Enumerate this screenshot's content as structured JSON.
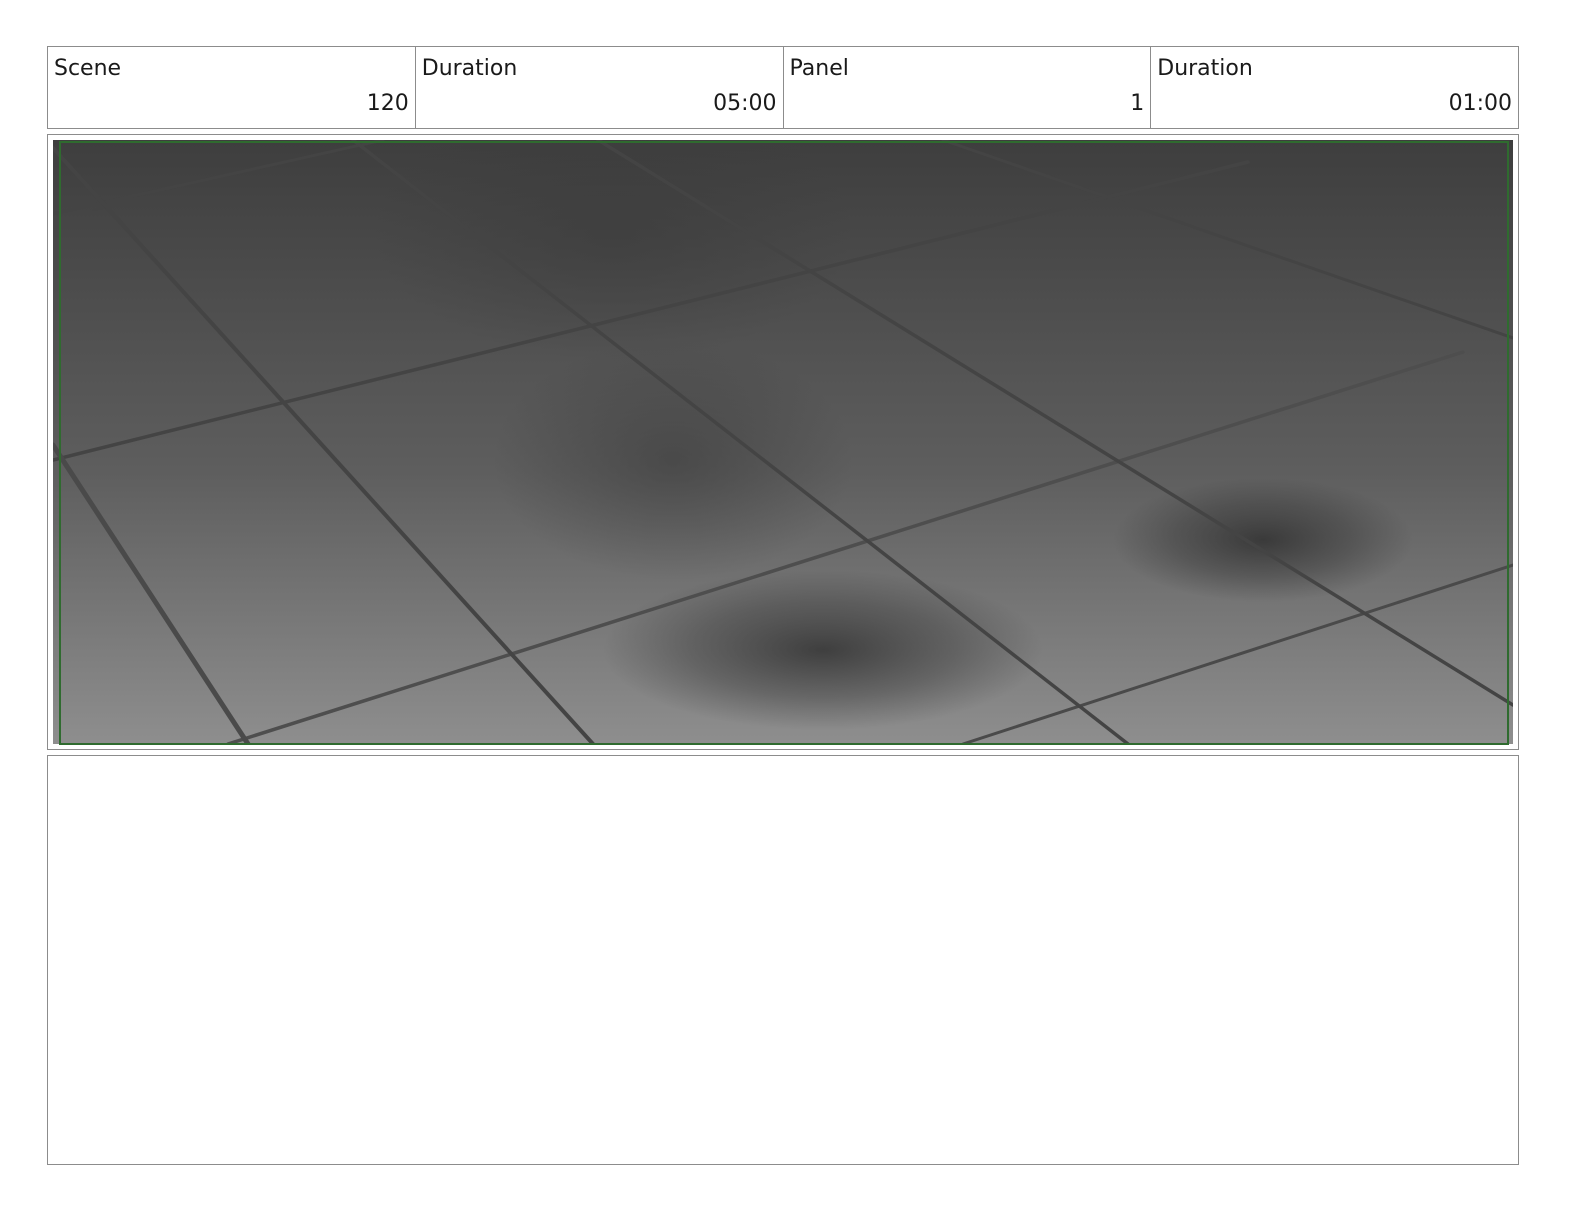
{
  "header": {
    "scene_label": "Scene",
    "scene_value": "120",
    "scene_duration_label": "Duration",
    "scene_duration_value": "05:00",
    "panel_label": "Panel",
    "panel_value": "1",
    "panel_duration_label": "Duration",
    "panel_duration_value": "01:00"
  },
  "panel": {
    "safe_frame_color": "#2f6b2f",
    "floor_colors": {
      "top": "#3e3e3e",
      "bottom": "#8e8e8e",
      "grid_line": "#444444",
      "shadow": "#2a2a2a"
    }
  },
  "notes": {
    "text": ""
  }
}
